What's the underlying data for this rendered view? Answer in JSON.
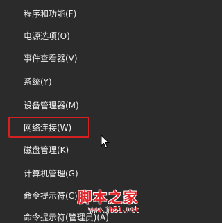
{
  "menu": {
    "items": [
      {
        "label": "程序和功能(F)"
      },
      {
        "label": "电源选项(O)"
      },
      {
        "label": "事件查看器(V)"
      },
      {
        "label": "系统(Y)"
      },
      {
        "label": "设备管理器(M)"
      },
      {
        "label": "网络连接(W)"
      },
      {
        "label": "磁盘管理(K)"
      },
      {
        "label": "计算机管理(G)"
      },
      {
        "label": "命令提示符(C)"
      },
      {
        "label": "命令提示符(管理员)(A)"
      }
    ],
    "highlighted_item": "网络连接(W)"
  },
  "watermark": {
    "title": "脚本之家",
    "url": "www.jb51.net"
  },
  "colors": {
    "menu_background": "#2b2b2b",
    "menu_text": "#f2f2f2",
    "highlight_border": "#d42020",
    "watermark_red": "#e3242b"
  },
  "icons": {
    "cursor": "mouse-pointer-icon"
  }
}
